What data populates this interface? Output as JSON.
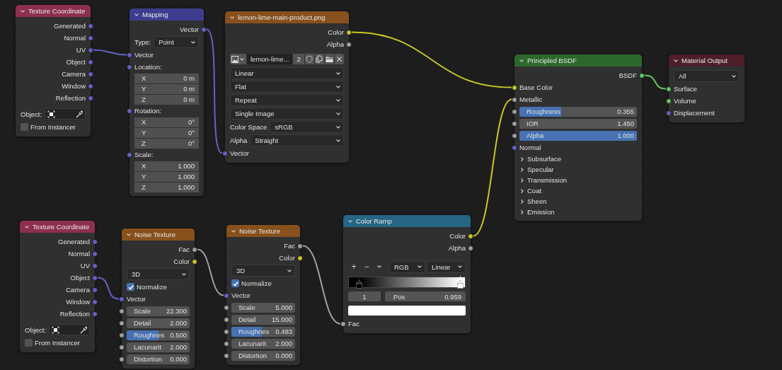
{
  "nodes": [
    {
      "title": "Texture Coordinate",
      "color": "#8e2f4e",
      "collapsed": false,
      "rows": [
        {
          "kind": "output",
          "label": "Generated",
          "color": "#6363c7"
        },
        {
          "kind": "output",
          "label": "Normal",
          "color": "#6363c7"
        },
        {
          "kind": "output",
          "label": "UV",
          "color": "#6363c7",
          "linked": true
        },
        {
          "kind": "output",
          "label": "Object",
          "color": "#6363c7"
        },
        {
          "kind": "output",
          "label": "Camera",
          "color": "#6363c7"
        },
        {
          "kind": "output",
          "label": "Window",
          "color": "#6363c7"
        },
        {
          "kind": "output",
          "label": "Reflection",
          "color": "#6363c7"
        },
        {
          "kind": "object_field",
          "label": "Object:"
        },
        {
          "kind": "checkbox",
          "label": "From Instancer",
          "checked": false
        }
      ]
    },
    {
      "title": "Mapping",
      "color": "#3d3d8f",
      "collapsed": false,
      "rows": [
        {
          "kind": "output",
          "label": "Vector",
          "color": "#6363c7",
          "linked": true
        },
        {
          "kind": "dropdown",
          "label": "Type:",
          "value": "Point"
        },
        {
          "kind": "input",
          "label": "Vector",
          "color": "#6363c7",
          "linked": true
        },
        {
          "kind": "input",
          "label": "Location:",
          "color": "#6363c7"
        },
        {
          "kind": "number",
          "label": "X",
          "value": "0 m"
        },
        {
          "kind": "number",
          "label": "Y",
          "value": "0 m"
        },
        {
          "kind": "number",
          "label": "Z",
          "value": "0 m"
        },
        {
          "kind": "input",
          "label": "Rotation:",
          "color": "#6363c7"
        },
        {
          "kind": "number",
          "label": "X",
          "value": "0°"
        },
        {
          "kind": "number",
          "label": "Y",
          "value": "0°"
        },
        {
          "kind": "number",
          "label": "Z",
          "value": "0°"
        },
        {
          "kind": "input",
          "label": "Scale:",
          "color": "#6363c7"
        },
        {
          "kind": "number",
          "label": "X",
          "value": "1.000"
        },
        {
          "kind": "number",
          "label": "Y",
          "value": "1.000"
        },
        {
          "kind": "number",
          "label": "Z",
          "value": "1.000"
        }
      ]
    },
    {
      "title": "lemon-lime-main-product.png",
      "color": "#87501c",
      "collapsed": false,
      "rows": [
        {
          "kind": "output",
          "label": "Color",
          "color": "#c7c729",
          "linked": true
        },
        {
          "kind": "output",
          "label": "Alpha",
          "color": "#a1a1a1"
        },
        {
          "kind": "image_selector",
          "name": "lemon-lime...",
          "users": "2"
        },
        {
          "kind": "dropdown",
          "value": "Linear"
        },
        {
          "kind": "dropdown",
          "value": "Flat"
        },
        {
          "kind": "dropdown",
          "value": "Repeat"
        },
        {
          "kind": "dropdown",
          "value": "Single Image"
        },
        {
          "kind": "dropdown",
          "label": "Color Space",
          "value": "sRGB"
        },
        {
          "kind": "dropdown",
          "label": "Alpha",
          "value": "Straight"
        },
        {
          "kind": "input",
          "label": "Vector",
          "color": "#6363c7",
          "linked": true
        }
      ]
    },
    {
      "title": "Principled BSDF",
      "color": "#2c682c",
      "collapsed": false,
      "rows": [
        {
          "kind": "output",
          "label": "BSDF",
          "color": "#63c763",
          "linked": true
        },
        {
          "kind": "input",
          "label": "Base Color",
          "color": "#c7c729",
          "linked": true
        },
        {
          "kind": "input",
          "label": "Metallic",
          "color": "#a1a1a1",
          "linked": true
        },
        {
          "kind": "slider",
          "label": "Roughness",
          "value": "0.355",
          "color": "#a1a1a1",
          "level": 0.355
        },
        {
          "kind": "slider",
          "label": "IOR",
          "value": "1.450",
          "color": "#a1a1a1"
        },
        {
          "kind": "slider",
          "label": "Alpha",
          "value": "1.000",
          "color": "#a1a1a1",
          "level": 1
        },
        {
          "kind": "input",
          "label": "Normal",
          "color": "#6363c7"
        },
        {
          "kind": "panel",
          "label": "Subsurface",
          "expanded": false
        },
        {
          "kind": "panel",
          "label": "Specular",
          "expanded": false
        },
        {
          "kind": "panel",
          "label": "Transmission",
          "expanded": false
        },
        {
          "kind": "panel",
          "label": "Coat",
          "expanded": false
        },
        {
          "kind": "panel",
          "label": "Sheen",
          "expanded": false
        },
        {
          "kind": "panel",
          "label": "Emission",
          "expanded": false
        }
      ]
    },
    {
      "title": "Material Output",
      "color": "#4c1f29",
      "collapsed": false,
      "rows": [
        {
          "kind": "dropdown",
          "value": "All"
        },
        {
          "kind": "input",
          "label": "Surface",
          "color": "#63c763",
          "linked": true
        },
        {
          "kind": "input",
          "label": "Volume",
          "color": "#63c763"
        },
        {
          "kind": "input",
          "label": "Displacement",
          "color": "#6363c7"
        }
      ]
    },
    {
      "title": "Texture Coordinate",
      "color": "#8e2f4e",
      "collapsed": false,
      "rows": [
        {
          "kind": "output",
          "label": "Generated",
          "color": "#6363c7"
        },
        {
          "kind": "output",
          "label": "Normal",
          "color": "#6363c7"
        },
        {
          "kind": "output",
          "label": "UV",
          "color": "#6363c7"
        },
        {
          "kind": "output",
          "label": "Object",
          "color": "#6363c7",
          "linked": true
        },
        {
          "kind": "output",
          "label": "Camera",
          "color": "#6363c7"
        },
        {
          "kind": "output",
          "label": "Window",
          "color": "#6363c7"
        },
        {
          "kind": "output",
          "label": "Reflection",
          "color": "#6363c7"
        },
        {
          "kind": "object_field",
          "label": "Object:"
        },
        {
          "kind": "checkbox",
          "label": "From Instancer",
          "checked": false
        }
      ]
    },
    {
      "title": "Noise Texture",
      "color": "#87501c",
      "collapsed": false,
      "rows": [
        {
          "kind": "output",
          "label": "Fac",
          "color": "#a1a1a1",
          "linked": true
        },
        {
          "kind": "output",
          "label": "Color",
          "color": "#c7c729"
        },
        {
          "kind": "dropdown",
          "value": "3D"
        },
        {
          "kind": "checkbox",
          "label": "Normalize",
          "checked": true
        },
        {
          "kind": "input",
          "label": "Vector",
          "color": "#6363c7",
          "linked": true
        },
        {
          "kind": "slider",
          "label": "Scale",
          "value": "22.300",
          "color": "#a1a1a1"
        },
        {
          "kind": "slider",
          "label": "Detail",
          "value": "2.000",
          "color": "#a1a1a1"
        },
        {
          "kind": "slider",
          "label": "Roughnes",
          "value": "0.500",
          "color": "#a1a1a1",
          "level": 0.5
        },
        {
          "kind": "slider",
          "label": "Lacunarit",
          "value": "2.000",
          "color": "#a1a1a1"
        },
        {
          "kind": "slider",
          "label": "Distortion",
          "value": "0.000",
          "color": "#a1a1a1"
        }
      ]
    },
    {
      "title": "Noise Texture",
      "color": "#87501c",
      "collapsed": false,
      "rows": [
        {
          "kind": "output",
          "label": "Fac",
          "color": "#a1a1a1",
          "linked": true
        },
        {
          "kind": "output",
          "label": "Color",
          "color": "#c7c729"
        },
        {
          "kind": "dropdown",
          "value": "3D"
        },
        {
          "kind": "checkbox",
          "label": "Normalize",
          "checked": true
        },
        {
          "kind": "input",
          "label": "Vector",
          "color": "#6363c7",
          "linked": true
        },
        {
          "kind": "slider",
          "label": "Scale",
          "value": "5.000",
          "color": "#a1a1a1"
        },
        {
          "kind": "slider",
          "label": "Detail",
          "value": "15.000",
          "color": "#a1a1a1"
        },
        {
          "kind": "slider",
          "label": "Roughnes",
          "value": "0.483",
          "color": "#a1a1a1",
          "level": 0.483
        },
        {
          "kind": "slider",
          "label": "Lacunarit",
          "value": "2.000",
          "color": "#a1a1a1"
        },
        {
          "kind": "slider",
          "label": "Distortion",
          "value": "0.000",
          "color": "#a1a1a1"
        }
      ]
    },
    {
      "title": "Color Ramp",
      "color": "#276585",
      "collapsed": false,
      "rows": [
        {
          "kind": "output",
          "label": "Color",
          "color": "#c7c729",
          "linked": true
        },
        {
          "kind": "output",
          "label": "Alpha",
          "color": "#a1a1a1"
        },
        {
          "kind": "ramp_toolbar",
          "buttons": [
            "+",
            "−"
          ],
          "mode": "RGB",
          "interpolation": "Linear"
        },
        {
          "kind": "ramp",
          "stops": [
            {
              "color": "#000000",
              "level": 0.09,
              "selected": false
            },
            {
              "color": "#ffffff",
              "level": 0.959,
              "selected": true
            }
          ]
        },
        {
          "kind": "ramp_fields",
          "index": "1",
          "label": "Pos",
          "value": "0.959"
        },
        {
          "kind": "swatch",
          "color": "#ffffff"
        },
        {
          "kind": "input",
          "label": "Fac",
          "color": "#a1a1a1",
          "linked": true
        }
      ]
    }
  ]
}
